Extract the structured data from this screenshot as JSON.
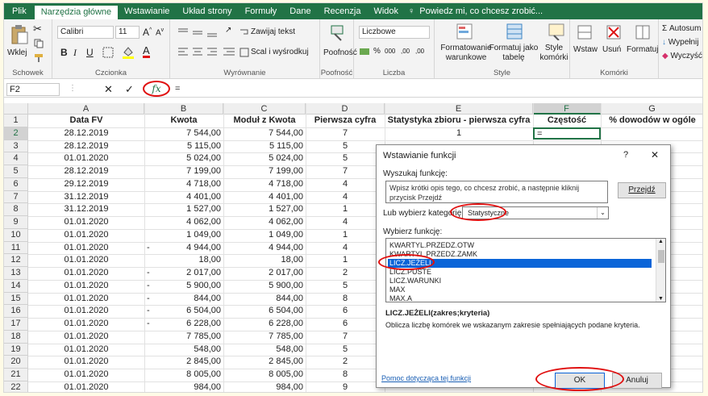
{
  "tabs": [
    "Plik",
    "Narzędzia główne",
    "Wstawianie",
    "Układ strony",
    "Formuły",
    "Dane",
    "Recenzja",
    "Widok"
  ],
  "tell_me": "Powiedz mi, co chcesz zrobić...",
  "ribbon": {
    "paste": "Wklej",
    "font_name": "Calibri",
    "font_size": "11",
    "wrap_text": "Zawijaj tekst",
    "merge": "Scal i wyśrodkuj",
    "number_format": "Liczbowe",
    "percent": "%",
    "thousands": "000",
    "dec_inc": ",00",
    "dec_dec": ",00",
    "conditional": "Formatowanie warunkowe",
    "format_table": "Formatuj jako tabelę",
    "cell_styles": "Style komórki",
    "insert": "Wstaw",
    "delete": "Usuń",
    "format": "Formatuj",
    "autosum": "Autosum",
    "fill": "Wypełnij",
    "clear": "Wyczyść",
    "align_label": "Poofność",
    "bold": "B",
    "italic": "I",
    "underline": "U",
    "font_a": "A",
    "groups": [
      "Schowek",
      "Czcionka",
      "Wyrównanie",
      "Poofność",
      "Liczba",
      "Style",
      "Komórki"
    ]
  },
  "formula_bar": {
    "name_box": "F2",
    "cancel": "✕",
    "confirm": "✓",
    "fx": "fx",
    "value": "="
  },
  "sheet": {
    "columns": [
      "A",
      "B",
      "C",
      "D",
      "E",
      "F",
      "G"
    ],
    "headers": [
      "Data FV",
      "Kwota",
      "Moduł z Kwota",
      "Pierwsza cyfra",
      "Statystyka zbioru - pierwsza cyfra",
      "Częstość",
      "% dowodów w ogóle"
    ],
    "row_numbers": [
      "1",
      "2",
      "3",
      "4",
      "5",
      "6",
      "7",
      "8",
      "9",
      "10",
      "11",
      "12",
      "13",
      "14",
      "15",
      "16",
      "17",
      "18",
      "19",
      "20",
      "21",
      "22"
    ],
    "rows": [
      {
        "date": "28.12.2019",
        "neg": "",
        "amount": "7 544,00",
        "abs": "7 544,00",
        "digit": "7"
      },
      {
        "date": "28.12.2019",
        "neg": "",
        "amount": "5 115,00",
        "abs": "5 115,00",
        "digit": "5"
      },
      {
        "date": "01.01.2020",
        "neg": "",
        "amount": "5 024,00",
        "abs": "5 024,00",
        "digit": "5"
      },
      {
        "date": "28.12.2019",
        "neg": "",
        "amount": "7 199,00",
        "abs": "7 199,00",
        "digit": "7"
      },
      {
        "date": "29.12.2019",
        "neg": "",
        "amount": "4 718,00",
        "abs": "4 718,00",
        "digit": "4"
      },
      {
        "date": "31.12.2019",
        "neg": "",
        "amount": "4 401,00",
        "abs": "4 401,00",
        "digit": "4"
      },
      {
        "date": "31.12.2019",
        "neg": "",
        "amount": "1 527,00",
        "abs": "1 527,00",
        "digit": "1"
      },
      {
        "date": "01.01.2020",
        "neg": "",
        "amount": "4 062,00",
        "abs": "4 062,00",
        "digit": "4"
      },
      {
        "date": "01.01.2020",
        "neg": "",
        "amount": "1 049,00",
        "abs": "1 049,00",
        "digit": "1"
      },
      {
        "date": "01.01.2020",
        "neg": "-",
        "amount": "4 944,00",
        "abs": "4 944,00",
        "digit": "4"
      },
      {
        "date": "01.01.2020",
        "neg": "",
        "amount": "18,00",
        "abs": "18,00",
        "digit": "1"
      },
      {
        "date": "01.01.2020",
        "neg": "-",
        "amount": "2 017,00",
        "abs": "2 017,00",
        "digit": "2"
      },
      {
        "date": "01.01.2020",
        "neg": "-",
        "amount": "5 900,00",
        "abs": "5 900,00",
        "digit": "5"
      },
      {
        "date": "01.01.2020",
        "neg": "-",
        "amount": "844,00",
        "abs": "844,00",
        "digit": "8"
      },
      {
        "date": "01.01.2020",
        "neg": "-",
        "amount": "6 504,00",
        "abs": "6 504,00",
        "digit": "6"
      },
      {
        "date": "01.01.2020",
        "neg": "-",
        "amount": "6 228,00",
        "abs": "6 228,00",
        "digit": "6"
      },
      {
        "date": "01.01.2020",
        "neg": "",
        "amount": "7 785,00",
        "abs": "7 785,00",
        "digit": "7"
      },
      {
        "date": "01.01.2020",
        "neg": "",
        "amount": "548,00",
        "abs": "548,00",
        "digit": "5"
      },
      {
        "date": "01.01.2020",
        "neg": "",
        "amount": "2 845,00",
        "abs": "2 845,00",
        "digit": "2"
      },
      {
        "date": "01.01.2020",
        "neg": "",
        "amount": "8 005,00",
        "abs": "8 005,00",
        "digit": "8"
      },
      {
        "date": "01.01.2020",
        "neg": "",
        "amount": "984,00",
        "abs": "984,00",
        "digit": "9"
      }
    ],
    "e2": "1",
    "f2": "="
  },
  "dialog": {
    "title": "Wstawianie funkcji",
    "help": "?",
    "close": "✕",
    "search_label": "Wyszukaj funkcję:",
    "search_placeholder": "Wpisz krótki opis tego, co chcesz zrobić, a następnie kliknij przycisk Przejdź",
    "go": "Przejdź",
    "category_label": "Lub wybierz kategorię:",
    "category": "Statystyczne",
    "select_label": "Wybierz funkcję:",
    "functions": [
      "KWARTYL.PRZEDZ.OTW",
      "KWARTYL.PRZEDZ.ZAMK",
      "LICZ.JEŻELI",
      "LICZ.PUSTE",
      "LICZ.WARUNKI",
      "MAX",
      "MAX.A"
    ],
    "selected_index": 2,
    "signature": "LICZ.JEŻELI(zakres;kryteria)",
    "description": "Oblicza liczbę komórek we wskazanym zakresie spełniających podane kryteria.",
    "help_link": "Pomoc dotycząca tej funkcji",
    "ok": "OK",
    "cancel": "Anuluj"
  },
  "colors": {
    "excel_green": "#217346",
    "selection": "#0a64d8",
    "annotation": "#e01010"
  }
}
